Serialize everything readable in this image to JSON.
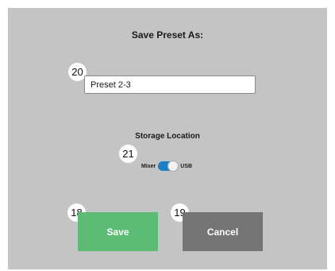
{
  "dialog": {
    "title": "Save Preset As:",
    "name_field": {
      "value": "Preset 2-3"
    },
    "storage": {
      "label": "Storage Location",
      "option_left": "Mixer",
      "option_right": "USB",
      "selected": "USB"
    },
    "buttons": {
      "save_label": "Save",
      "cancel_label": "Cancel"
    },
    "callouts": {
      "name_field": "20",
      "storage_toggle": "21",
      "save": "18",
      "cancel": "19"
    }
  },
  "colors": {
    "panel_background": "#c4c4c4",
    "save_button": "#5cbb74",
    "cancel_button": "#747474",
    "toggle_on": "#1f7fc6"
  }
}
